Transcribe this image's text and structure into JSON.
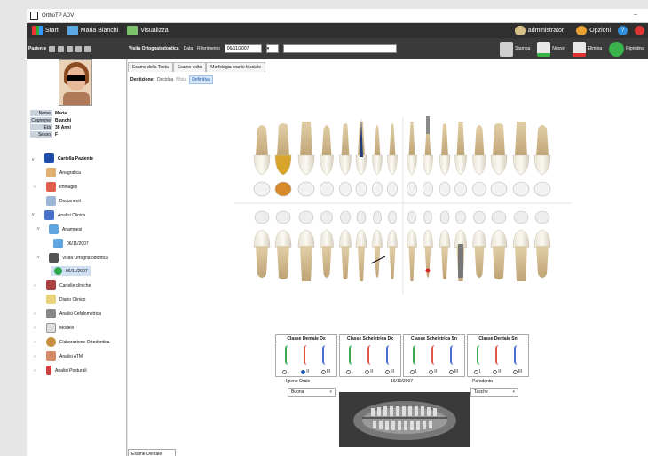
{
  "window": {
    "title": "OrthoTP ADV",
    "minimize": "–"
  },
  "menubar": {
    "start_label": "Start",
    "patient_label": "Maria Bianchi",
    "view_label": "Visualizza",
    "user_label": "administrator",
    "options_label": "Opzioni",
    "help_label": "?",
    "power_icon": "power-icon"
  },
  "toolbar": {
    "patient_label": "Paziente",
    "visit_title": "Visita Ortognatodontica",
    "date_label": "Data",
    "reference_label": "Riferimento",
    "date_value": "06/11/2007",
    "actions": {
      "print": "Stampa",
      "new": "Nuovo",
      "delete": "Elimina",
      "restore": "Ripristina"
    }
  },
  "patient": {
    "fields": [
      {
        "k": "Nome",
        "v": "Maria"
      },
      {
        "k": "Cognome",
        "v": "Bianchi"
      },
      {
        "k": "Età",
        "v": "38 Anni"
      },
      {
        "k": "Sesso",
        "v": "F"
      }
    ]
  },
  "tree": {
    "root": "Cartella Paziente",
    "items": [
      "Anagrafica",
      "Immagini",
      "Documenti",
      "Analisi Clinica",
      "Anamnesi",
      "06/11/2007",
      "Visita Ortognatodontica",
      "06/11/2007",
      "Cartelle cliniche",
      "Diario Clinico",
      "Analisi Cefalometrica",
      "Modelli",
      "Elaborazione Ortodontica",
      "Analisi ATM",
      "Analisi Posturali"
    ]
  },
  "tabs": [
    "Esame Dentale",
    "Esame della Testa",
    "Esame volto",
    "Morfologia cranio facciale"
  ],
  "dentition": {
    "label": "Dentizione:",
    "options": [
      "Decidua",
      "Mista",
      "Definitiva"
    ]
  },
  "classes": [
    {
      "title": "Classe Dentale Dx",
      "selected": "II",
      "colors": [
        "#3aa655",
        "#e0574a",
        "#4a6fd0"
      ]
    },
    {
      "title": "Classe Scheletrica Dx",
      "selected": "",
      "colors": [
        "#3aa655",
        "#e0574a",
        "#4a6fd0"
      ]
    },
    {
      "title": "Classe Scheletrica Sn",
      "selected": "",
      "colors": [
        "#3aa655",
        "#e0574a",
        "#4a6fd0"
      ]
    },
    {
      "title": "Classe Dentale Sn",
      "selected": "",
      "colors": [
        "#3aa655",
        "#e0574a",
        "#4a6fd0"
      ]
    }
  ],
  "radio_labels": [
    "I",
    "II",
    "III"
  ],
  "bottom": {
    "hygiene_label": "Igiene Orale",
    "date": "16/10/2007",
    "perio_label": "Parodonto",
    "hygiene_value": "Buona",
    "perio_value": "Tasche"
  }
}
